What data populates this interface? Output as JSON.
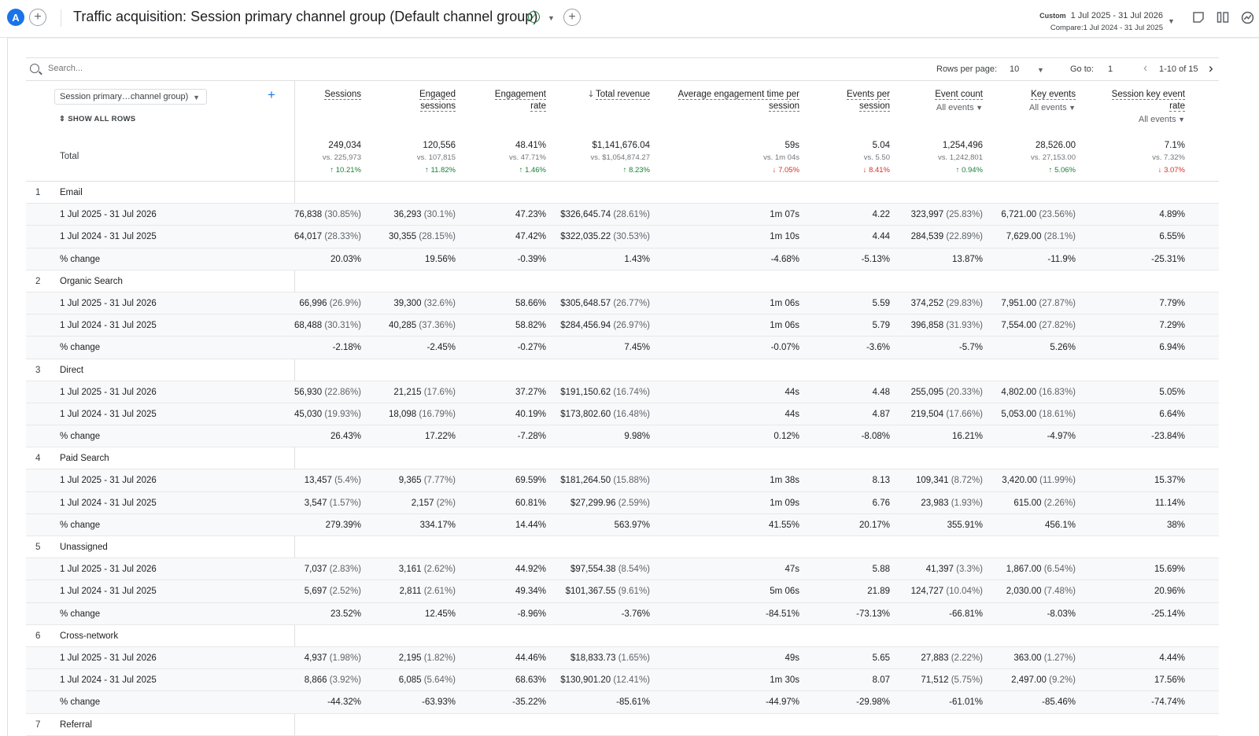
{
  "header": {
    "avatar_letter": "A",
    "title": "Traffic acquisition: Session primary channel group (Default channel group)",
    "date_label": "Custom",
    "date_range": "1 Jul 2025 - 31 Jul 2026",
    "compare_range": "Compare:1 Jul 2024 - 31 Jul 2025"
  },
  "toolbar": {
    "search_placeholder": "Search...",
    "rows_per_page_label": "Rows per page:",
    "rows_per_page_value": "10",
    "goto_label": "Go to:",
    "goto_value": "1",
    "pagination": "1-10 of 15"
  },
  "table": {
    "dimension_selector": "Session primary…channel group)",
    "show_all_rows": "SHOW ALL ROWS",
    "total_label": "Total",
    "columns": [
      {
        "l1": "Sessions",
        "l2": "",
        "sub": ""
      },
      {
        "l1": "Engaged",
        "l2": "sessions",
        "sub": ""
      },
      {
        "l1": "Engagement",
        "l2": "rate",
        "sub": ""
      },
      {
        "l1": "Total revenue",
        "l2": "",
        "sub": ""
      },
      {
        "l1": "Average engagement time per",
        "l2": "session",
        "sub": ""
      },
      {
        "l1": "Events per",
        "l2": "session",
        "sub": ""
      },
      {
        "l1": "Event count",
        "l2": "",
        "sub": "All events"
      },
      {
        "l1": "Key events",
        "l2": "",
        "sub": "All events"
      },
      {
        "l1": "Session key event",
        "l2": "rate",
        "sub": "All events"
      }
    ],
    "totals": [
      {
        "v": "249,034",
        "c": "vs. 225,973",
        "d": "10.21%",
        "dir": "up"
      },
      {
        "v": "120,556",
        "c": "vs. 107,815",
        "d": "11.82%",
        "dir": "up"
      },
      {
        "v": "48.41%",
        "c": "vs. 47.71%",
        "d": "1.46%",
        "dir": "up"
      },
      {
        "v": "$1,141,676.04",
        "c": "vs. $1,054,874.27",
        "d": "8.23%",
        "dir": "up"
      },
      {
        "v": "59s",
        "c": "vs. 1m 04s",
        "d": "7.05%",
        "dir": "down"
      },
      {
        "v": "5.04",
        "c": "vs. 5.50",
        "d": "8.41%",
        "dir": "down"
      },
      {
        "v": "1,254,496",
        "c": "vs. 1,242,801",
        "d": "0.94%",
        "dir": "up"
      },
      {
        "v": "28,526.00",
        "c": "vs. 27,153.00",
        "d": "5.06%",
        "dir": "up"
      },
      {
        "v": "7.1%",
        "c": "vs. 7.32%",
        "d": "3.07%",
        "dir": "down"
      }
    ],
    "rows": [
      {
        "t": "g",
        "n": "1",
        "l": "Email",
        "c": []
      },
      {
        "t": "s",
        "l": "1 Jul 2025 - 31 Jul 2026",
        "c": [
          [
            "76,838",
            " (30.85%)"
          ],
          [
            "36,293",
            " (30.1%)"
          ],
          [
            "47.23%",
            ""
          ],
          [
            "$326,645.74",
            " (28.61%)"
          ],
          [
            "1m 07s",
            ""
          ],
          [
            "4.22",
            ""
          ],
          [
            "323,997",
            " (25.83%)"
          ],
          [
            "6,721.00",
            " (23.56%)"
          ],
          [
            "4.89%",
            ""
          ]
        ]
      },
      {
        "t": "s",
        "l": "1 Jul 2024 - 31 Jul 2025",
        "c": [
          [
            "64,017",
            " (28.33%)"
          ],
          [
            "30,355",
            " (28.15%)"
          ],
          [
            "47.42%",
            ""
          ],
          [
            "$322,035.22",
            " (30.53%)"
          ],
          [
            "1m 10s",
            ""
          ],
          [
            "4.44",
            ""
          ],
          [
            "284,539",
            " (22.89%)"
          ],
          [
            "7,629.00",
            " (28.1%)"
          ],
          [
            "6.55%",
            ""
          ]
        ]
      },
      {
        "t": "s",
        "l": "% change",
        "c": [
          [
            "20.03%",
            ""
          ],
          [
            "19.56%",
            ""
          ],
          [
            "-0.39%",
            ""
          ],
          [
            "1.43%",
            ""
          ],
          [
            "-4.68%",
            ""
          ],
          [
            "-5.13%",
            ""
          ],
          [
            "13.87%",
            ""
          ],
          [
            "-11.9%",
            ""
          ],
          [
            "-25.31%",
            ""
          ]
        ]
      },
      {
        "t": "g",
        "n": "2",
        "l": "Organic Search",
        "c": []
      },
      {
        "t": "s",
        "l": "1 Jul 2025 - 31 Jul 2026",
        "c": [
          [
            "66,996",
            " (26.9%)"
          ],
          [
            "39,300",
            " (32.6%)"
          ],
          [
            "58.66%",
            ""
          ],
          [
            "$305,648.57",
            " (26.77%)"
          ],
          [
            "1m 06s",
            ""
          ],
          [
            "5.59",
            ""
          ],
          [
            "374,252",
            " (29.83%)"
          ],
          [
            "7,951.00",
            " (27.87%)"
          ],
          [
            "7.79%",
            ""
          ]
        ]
      },
      {
        "t": "s",
        "l": "1 Jul 2024 - 31 Jul 2025",
        "c": [
          [
            "68,488",
            " (30.31%)"
          ],
          [
            "40,285",
            " (37.36%)"
          ],
          [
            "58.82%",
            ""
          ],
          [
            "$284,456.94",
            " (26.97%)"
          ],
          [
            "1m 06s",
            ""
          ],
          [
            "5.79",
            ""
          ],
          [
            "396,858",
            " (31.93%)"
          ],
          [
            "7,554.00",
            " (27.82%)"
          ],
          [
            "7.29%",
            ""
          ]
        ]
      },
      {
        "t": "s",
        "l": "% change",
        "c": [
          [
            "-2.18%",
            ""
          ],
          [
            "-2.45%",
            ""
          ],
          [
            "-0.27%",
            ""
          ],
          [
            "7.45%",
            ""
          ],
          [
            "-0.07%",
            ""
          ],
          [
            "-3.6%",
            ""
          ],
          [
            "-5.7%",
            ""
          ],
          [
            "5.26%",
            ""
          ],
          [
            "6.94%",
            ""
          ]
        ]
      },
      {
        "t": "g",
        "n": "3",
        "l": "Direct",
        "c": []
      },
      {
        "t": "s",
        "l": "1 Jul 2025 - 31 Jul 2026",
        "c": [
          [
            "56,930",
            " (22.86%)"
          ],
          [
            "21,215",
            " (17.6%)"
          ],
          [
            "37.27%",
            ""
          ],
          [
            "$191,150.62",
            " (16.74%)"
          ],
          [
            "44s",
            ""
          ],
          [
            "4.48",
            ""
          ],
          [
            "255,095",
            " (20.33%)"
          ],
          [
            "4,802.00",
            " (16.83%)"
          ],
          [
            "5.05%",
            ""
          ]
        ]
      },
      {
        "t": "s",
        "l": "1 Jul 2024 - 31 Jul 2025",
        "c": [
          [
            "45,030",
            " (19.93%)"
          ],
          [
            "18,098",
            " (16.79%)"
          ],
          [
            "40.19%",
            ""
          ],
          [
            "$173,802.60",
            " (16.48%)"
          ],
          [
            "44s",
            ""
          ],
          [
            "4.87",
            ""
          ],
          [
            "219,504",
            " (17.66%)"
          ],
          [
            "5,053.00",
            " (18.61%)"
          ],
          [
            "6.64%",
            ""
          ]
        ]
      },
      {
        "t": "s",
        "l": "% change",
        "c": [
          [
            "26.43%",
            ""
          ],
          [
            "17.22%",
            ""
          ],
          [
            "-7.28%",
            ""
          ],
          [
            "9.98%",
            ""
          ],
          [
            "0.12%",
            ""
          ],
          [
            "-8.08%",
            ""
          ],
          [
            "16.21%",
            ""
          ],
          [
            "-4.97%",
            ""
          ],
          [
            "-23.84%",
            ""
          ]
        ]
      },
      {
        "t": "g",
        "n": "4",
        "l": "Paid Search",
        "c": []
      },
      {
        "t": "s",
        "l": "1 Jul 2025 - 31 Jul 2026",
        "c": [
          [
            "13,457",
            " (5.4%)"
          ],
          [
            "9,365",
            " (7.77%)"
          ],
          [
            "69.59%",
            ""
          ],
          [
            "$181,264.50",
            " (15.88%)"
          ],
          [
            "1m 38s",
            ""
          ],
          [
            "8.13",
            ""
          ],
          [
            "109,341",
            " (8.72%)"
          ],
          [
            "3,420.00",
            " (11.99%)"
          ],
          [
            "15.37%",
            ""
          ]
        ]
      },
      {
        "t": "s",
        "l": "1 Jul 2024 - 31 Jul 2025",
        "c": [
          [
            "3,547",
            " (1.57%)"
          ],
          [
            "2,157",
            " (2%)"
          ],
          [
            "60.81%",
            ""
          ],
          [
            "$27,299.96",
            " (2.59%)"
          ],
          [
            "1m 09s",
            ""
          ],
          [
            "6.76",
            ""
          ],
          [
            "23,983",
            " (1.93%)"
          ],
          [
            "615.00",
            " (2.26%)"
          ],
          [
            "11.14%",
            ""
          ]
        ]
      },
      {
        "t": "s",
        "l": "% change",
        "c": [
          [
            "279.39%",
            ""
          ],
          [
            "334.17%",
            ""
          ],
          [
            "14.44%",
            ""
          ],
          [
            "563.97%",
            ""
          ],
          [
            "41.55%",
            ""
          ],
          [
            "20.17%",
            ""
          ],
          [
            "355.91%",
            ""
          ],
          [
            "456.1%",
            ""
          ],
          [
            "38%",
            ""
          ]
        ]
      },
      {
        "t": "g",
        "n": "5",
        "l": "Unassigned",
        "c": []
      },
      {
        "t": "s",
        "l": "1 Jul 2025 - 31 Jul 2026",
        "c": [
          [
            "7,037",
            " (2.83%)"
          ],
          [
            "3,161",
            " (2.62%)"
          ],
          [
            "44.92%",
            ""
          ],
          [
            "$97,554.38",
            " (8.54%)"
          ],
          [
            "47s",
            ""
          ],
          [
            "5.88",
            ""
          ],
          [
            "41,397",
            " (3.3%)"
          ],
          [
            "1,867.00",
            " (6.54%)"
          ],
          [
            "15.69%",
            ""
          ]
        ]
      },
      {
        "t": "s",
        "l": "1 Jul 2024 - 31 Jul 2025",
        "c": [
          [
            "5,697",
            " (2.52%)"
          ],
          [
            "2,811",
            " (2.61%)"
          ],
          [
            "49.34%",
            ""
          ],
          [
            "$101,367.55",
            " (9.61%)"
          ],
          [
            "5m 06s",
            ""
          ],
          [
            "21.89",
            ""
          ],
          [
            "124,727",
            " (10.04%)"
          ],
          [
            "2,030.00",
            " (7.48%)"
          ],
          [
            "20.96%",
            ""
          ]
        ]
      },
      {
        "t": "s",
        "l": "% change",
        "c": [
          [
            "23.52%",
            ""
          ],
          [
            "12.45%",
            ""
          ],
          [
            "-8.96%",
            ""
          ],
          [
            "-3.76%",
            ""
          ],
          [
            "-84.51%",
            ""
          ],
          [
            "-73.13%",
            ""
          ],
          [
            "-66.81%",
            ""
          ],
          [
            "-8.03%",
            ""
          ],
          [
            "-25.14%",
            ""
          ]
        ]
      },
      {
        "t": "g",
        "n": "6",
        "l": "Cross-network",
        "c": []
      },
      {
        "t": "s",
        "l": "1 Jul 2025 - 31 Jul 2026",
        "c": [
          [
            "4,937",
            " (1.98%)"
          ],
          [
            "2,195",
            " (1.82%)"
          ],
          [
            "44.46%",
            ""
          ],
          [
            "$18,833.73",
            " (1.65%)"
          ],
          [
            "49s",
            ""
          ],
          [
            "5.65",
            ""
          ],
          [
            "27,883",
            " (2.22%)"
          ],
          [
            "363.00",
            " (1.27%)"
          ],
          [
            "4.44%",
            ""
          ]
        ]
      },
      {
        "t": "s",
        "l": "1 Jul 2024 - 31 Jul 2025",
        "c": [
          [
            "8,866",
            " (3.92%)"
          ],
          [
            "6,085",
            " (5.64%)"
          ],
          [
            "68.63%",
            ""
          ],
          [
            "$130,901.20",
            " (12.41%)"
          ],
          [
            "1m 30s",
            ""
          ],
          [
            "8.07",
            ""
          ],
          [
            "71,512",
            " (5.75%)"
          ],
          [
            "2,497.00",
            " (9.2%)"
          ],
          [
            "17.56%",
            ""
          ]
        ]
      },
      {
        "t": "s",
        "l": "% change",
        "c": [
          [
            "-44.32%",
            ""
          ],
          [
            "-63.93%",
            ""
          ],
          [
            "-35.22%",
            ""
          ],
          [
            "-85.61%",
            ""
          ],
          [
            "-44.97%",
            ""
          ],
          [
            "-29.98%",
            ""
          ],
          [
            "-61.01%",
            ""
          ],
          [
            "-85.46%",
            ""
          ],
          [
            "-74.74%",
            ""
          ]
        ]
      },
      {
        "t": "g",
        "n": "7",
        "l": "Referral",
        "c": []
      }
    ]
  }
}
